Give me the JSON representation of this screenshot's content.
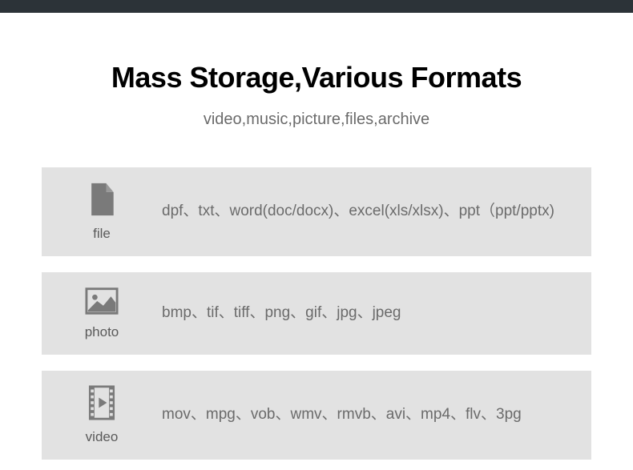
{
  "header": {
    "title": "Mass Storage,Various Formats",
    "subtitle": "video,music,picture,files,archive"
  },
  "cards": {
    "file": {
      "label": "file",
      "formats": "dpf、txt、word(doc/docx)、excel(xls/xlsx)、ppt（ppt/pptx)"
    },
    "photo": {
      "label": "photo",
      "formats": "bmp、tif、tiff、png、gif、jpg、jpeg"
    },
    "video": {
      "label": "video",
      "formats": "mov、mpg、vob、wmv、rmvb、avi、mp4、flv、3pg"
    }
  }
}
